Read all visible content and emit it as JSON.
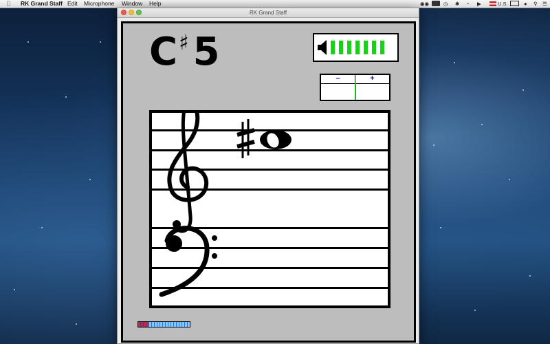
{
  "menubar": {
    "app_name": "RK Grand Staff",
    "menus": [
      "Edit",
      "Microphone",
      "Window",
      "Help"
    ],
    "input_source": "U.S."
  },
  "window": {
    "title": "RK Grand Staff"
  },
  "note": {
    "letter": "C",
    "accidental": "♯",
    "octave": "5"
  },
  "volume": {
    "bars_lit": 7,
    "bar_color": "#17d217"
  },
  "tuner": {
    "minus_label": "–",
    "plus_label": "+",
    "offset": 0
  },
  "staff": {
    "note_accidental": "♯",
    "clefs": [
      "treble-clef",
      "bass-clef"
    ]
  },
  "input_level": {
    "level": 0.2
  },
  "colors": {
    "accent_green": "#17d217",
    "button_text": "#1a1ab8"
  }
}
